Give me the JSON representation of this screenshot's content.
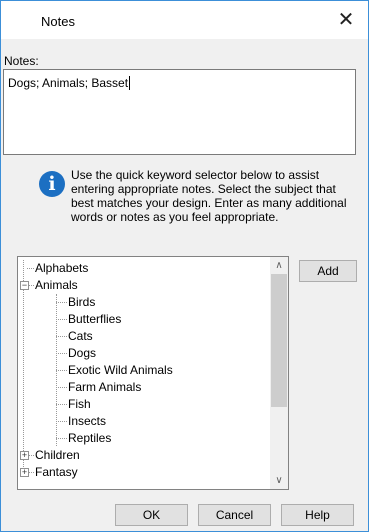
{
  "window": {
    "title": "Notes",
    "close_glyph": "✕"
  },
  "notes": {
    "label": "Notes:",
    "value": "Dogs; Animals; Basset"
  },
  "info": {
    "icon": "info-icon",
    "text": "Use the quick keyword selector below to assist entering appropriate notes. Select the subject that best matches your design. Enter as many additional words or notes as you feel appropriate."
  },
  "tree": {
    "items": [
      {
        "label": "Alphabets",
        "level": 0
      },
      {
        "label": "Animals",
        "level": 0,
        "expanded": true,
        "selected": true
      },
      {
        "label": "Birds",
        "level": 1
      },
      {
        "label": "Butterflies",
        "level": 1
      },
      {
        "label": "Cats",
        "level": 1
      },
      {
        "label": "Dogs",
        "level": 1
      },
      {
        "label": "Exotic Wild Animals",
        "level": 1
      },
      {
        "label": "Farm Animals",
        "level": 1
      },
      {
        "label": "Fish",
        "level": 1
      },
      {
        "label": "Insects",
        "level": 1
      },
      {
        "label": "Reptiles",
        "level": 1
      },
      {
        "label": "Children",
        "level": 0,
        "expanded": false
      },
      {
        "label": "Fantasy",
        "level": 0,
        "expanded": false
      }
    ],
    "scroll_up": "∧",
    "scroll_down": "∨"
  },
  "buttons": {
    "add": "Add",
    "ok": "OK",
    "cancel": "Cancel",
    "help": "Help"
  }
}
